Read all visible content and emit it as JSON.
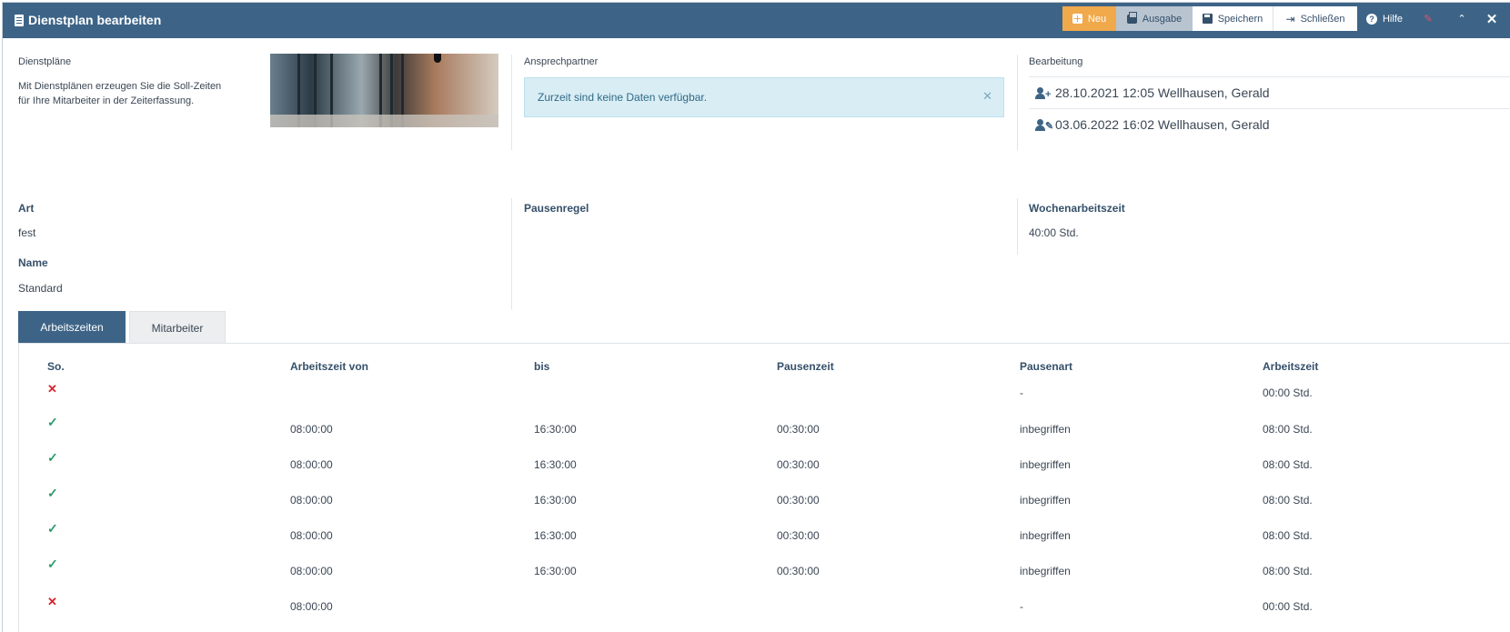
{
  "header": {
    "title": "Dienstplan bearbeiten",
    "buttons": {
      "neu": "Neu",
      "ausgabe": "Ausgabe",
      "speichern": "Speichern",
      "schliessen": "Schließen",
      "hilfe": "Hilfe"
    }
  },
  "info": {
    "dienstplaene_label": "Dienstpläne",
    "dienstplaene_text": "Mit Dienstplänen erzeugen Sie die Soll-Zeiten für Ihre Mitarbeiter in der Zeiterfassung.",
    "ansprechpartner_label": "Ansprechpartner",
    "alert_text": "Zurzeit sind keine Daten verfügbar.",
    "bearbeitung_label": "Bearbeitung",
    "bearbeitung": [
      {
        "icon": "user-add-icon",
        "text": "28.10.2021 12:05 Wellhausen, Gerald"
      },
      {
        "icon": "user-edit-icon",
        "text": "03.06.2022 16:02 Wellhausen, Gerald"
      }
    ]
  },
  "fields": {
    "art_label": "Art",
    "art_value": "fest",
    "name_label": "Name",
    "name_value": "Standard",
    "pausenregel_label": "Pausenregel",
    "wochenarbeitszeit_label": "Wochenarbeitszeit",
    "wochenarbeitszeit_value": "40:00 Std."
  },
  "tabs": {
    "arbeitszeiten": "Arbeitszeiten",
    "mitarbeiter": "Mitarbeiter"
  },
  "table": {
    "headers": [
      "So.",
      "Arbeitszeit von",
      "bis",
      "Pausenzeit",
      "Pausenart",
      "Arbeitszeit"
    ],
    "rows": [
      {
        "active": false,
        "von": "",
        "bis": "",
        "pausenzeit": "",
        "pausenart": "-",
        "arbeitszeit": "00:00 Std."
      },
      {
        "active": true,
        "von": "08:00:00",
        "bis": "16:30:00",
        "pausenzeit": "00:30:00",
        "pausenart": "inbegriffen",
        "arbeitszeit": "08:00 Std."
      },
      {
        "active": true,
        "von": "08:00:00",
        "bis": "16:30:00",
        "pausenzeit": "00:30:00",
        "pausenart": "inbegriffen",
        "arbeitszeit": "08:00 Std."
      },
      {
        "active": true,
        "von": "08:00:00",
        "bis": "16:30:00",
        "pausenzeit": "00:30:00",
        "pausenart": "inbegriffen",
        "arbeitszeit": "08:00 Std."
      },
      {
        "active": true,
        "von": "08:00:00",
        "bis": "16:30:00",
        "pausenzeit": "00:30:00",
        "pausenart": "inbegriffen",
        "arbeitszeit": "08:00 Std."
      },
      {
        "active": true,
        "von": "08:00:00",
        "bis": "16:30:00",
        "pausenzeit": "00:30:00",
        "pausenart": "inbegriffen",
        "arbeitszeit": "08:00 Std."
      },
      {
        "active": false,
        "von": "08:00:00",
        "bis": "",
        "pausenzeit": "",
        "pausenart": "-",
        "arbeitszeit": "00:00 Std."
      }
    ]
  },
  "colors": {
    "header_bg": "#3d6487",
    "accent_orange": "#f0a94b",
    "check_green": "#2e9a6c",
    "cross_red": "#d9232d"
  }
}
